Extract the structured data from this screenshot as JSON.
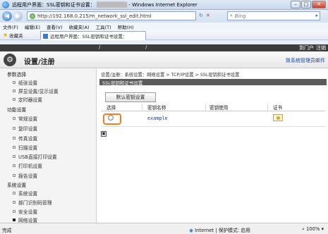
{
  "window": {
    "title": "远程用户界面：SSL密钥和证书设置：",
    "app_name": "- Windows Internet Explorer",
    "buttons": {
      "minimize": "–",
      "maximize": "□",
      "close": "✕"
    }
  },
  "browser": {
    "back_icon": "back-arrow-icon",
    "url": "http://192.168.0.215/m_network_ssl_edit.html",
    "search_placeholder": "Bing",
    "menu": [
      "文件(F)",
      "编辑(E)",
      "查看(V)",
      "收藏夹(A)",
      "工具(T)",
      "帮助(H)"
    ],
    "favorites_label": "收藏夹",
    "tab_title": "远程用户界面：SSL密钥和证书设置：",
    "status_done": "完成",
    "status_zone": "Internet | 保护模式: 启用",
    "zoom": "100%"
  },
  "topbar": {
    "slash1": "/",
    "slash2": "/",
    "portal": "到门户",
    "logout": "注销"
  },
  "header": {
    "title": "设置/注册",
    "mail": "致系统管理员邮件"
  },
  "sidebar": {
    "groups": [
      {
        "label": "参数选择",
        "items": [
          "纸张设置",
          "屏显设置/显示设置",
          "定时器设置"
        ]
      },
      {
        "label": "功能设置",
        "items": [
          "常规设置",
          "复印设置",
          "传真设置",
          "扫描设置",
          "USB直接打印设置",
          "打印机设置",
          "报告设置"
        ]
      },
      {
        "label": "系统设置",
        "items": [
          "系统设置",
          "部门识别码管理",
          "安全设置",
          "网络设置"
        ]
      }
    ]
  },
  "main": {
    "breadcrumb": "设置/注册：系统设置：网络设置 > TCP/IP设置 > SSL密钥和证书设置",
    "section_title": "SSL密钥和证书设置",
    "default_button": "默认密钥设置",
    "table": {
      "headers": [
        "选择",
        "密钥名称",
        "密钥使用",
        "证书"
      ],
      "rows": [
        {
          "selected": false,
          "key_name": "example",
          "usage": ""
        }
      ]
    },
    "bottom_marker": "▣"
  }
}
